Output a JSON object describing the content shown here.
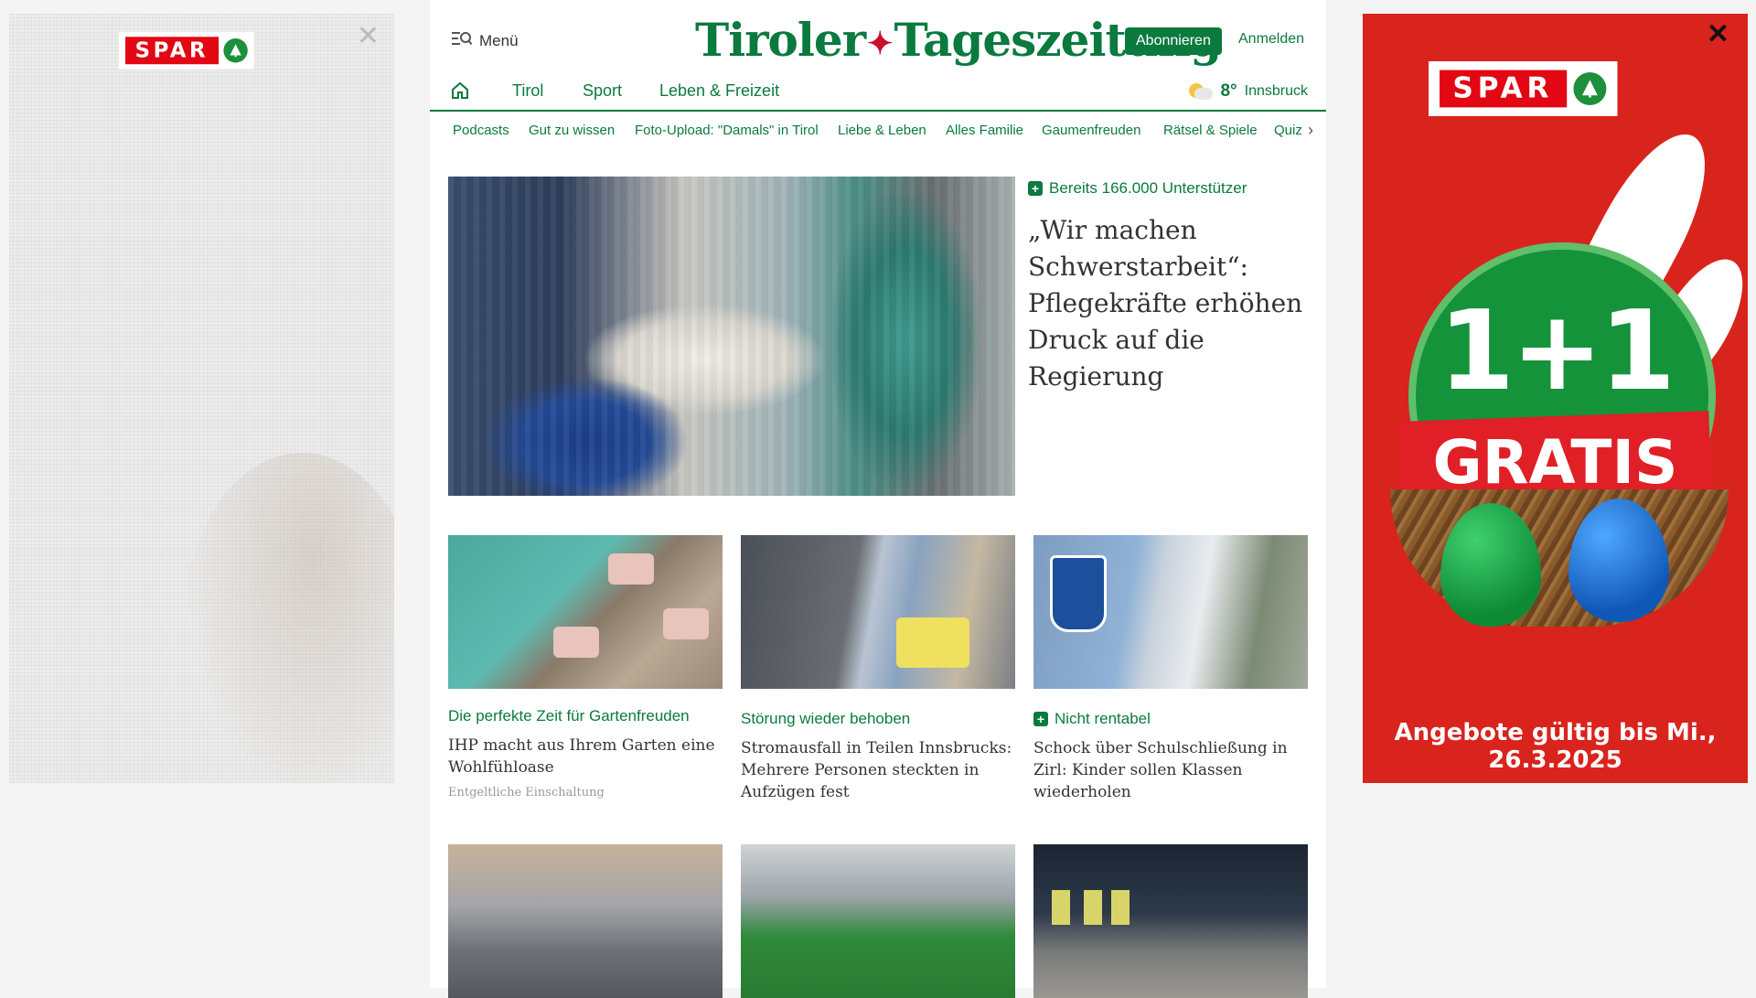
{
  "ad_left": {
    "brand": "SPAR",
    "close_icon": "close-icon"
  },
  "header": {
    "menu_label": "Menü",
    "menu_icon": "search-menu-icon",
    "logo_left": "Tiroler",
    "logo_right": "Tageszeitung",
    "subscribe_label": "Abonnieren",
    "login_label": "Anmelden"
  },
  "nav_main": {
    "home_icon": "home-icon",
    "items": [
      "Tirol",
      "Sport",
      "Leben & Freizeit"
    ]
  },
  "weather": {
    "icon": "partly-sunny-icon",
    "temperature": "8°",
    "city": "Innsbruck"
  },
  "nav_sub": {
    "items": [
      "Podcasts",
      "Gut zu wissen",
      "Foto-Upload: \"Damals\" in Tirol",
      "Liebe & Leben",
      "Alles Familie",
      "Gaumenfreuden",
      "Rätsel & Spiele",
      "Quiz"
    ],
    "more_icon": "chevron-right-icon"
  },
  "hero": {
    "tag": "Bereits 166.000 Unterstützer",
    "title": "„Wir machen Schwerstarbeit“: Pflegekräfte erhöhen Druck auf die Regierung"
  },
  "cards": [
    {
      "kicker": "Die perfekte Zeit für Gartenfreuden",
      "title": "IHP macht aus Ihrem Garten eine Wohlfühloase",
      "sponsor": "Entgeltliche Einschaltung"
    },
    {
      "kicker": "Störung wieder behoben",
      "title": "Stromausfall in Teilen Innsbrucks: Mehrere Personen steckten in Aufzügen fest"
    },
    {
      "kicker": "Nicht rentabel",
      "title": "Schock über Schulschließung in Zirl: Kinder sollen Klassen wiederholen"
    }
  ],
  "ad_right": {
    "brand": "SPAR",
    "offer": "1+1",
    "offer_word": "GRATIS",
    "validity": "Angebote gültig bis Mi., 26.3.2025"
  },
  "colors": {
    "brand_green": "#0a7a3e",
    "spar_red": "#e30613",
    "ad_red": "#d9231d"
  }
}
